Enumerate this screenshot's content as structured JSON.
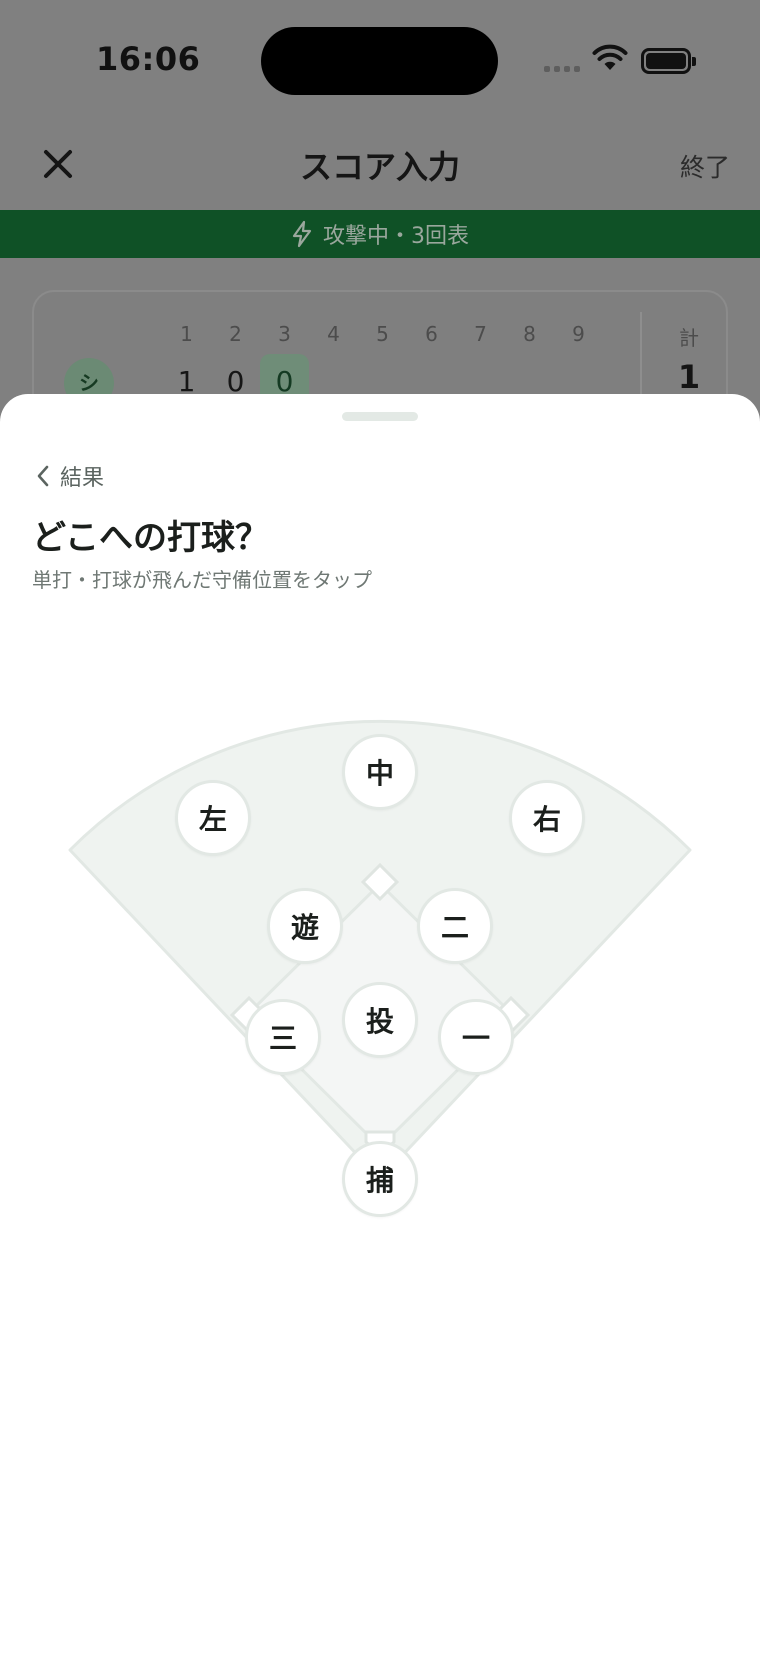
{
  "status_bar": {
    "time": "16:06"
  },
  "nav": {
    "title": "スコア入力",
    "finish_label": "終了"
  },
  "banner": {
    "text": "攻撃中・3回表"
  },
  "scoreboard": {
    "innings": [
      "1",
      "2",
      "3",
      "4",
      "5",
      "6",
      "7",
      "8",
      "9"
    ],
    "team_badge": "シ",
    "runs": [
      "1",
      "0",
      "0"
    ],
    "current_inning_index": 2,
    "total_label": "計",
    "total_value": "1"
  },
  "sheet": {
    "back_label": "結果",
    "title": "どこへの打球？",
    "subtitle": "単打・打球が飛んだ守備位置をタップ"
  },
  "positions": {
    "center": "中",
    "left": "左",
    "right": "右",
    "shortstop": "遊",
    "second": "二",
    "third": "三",
    "pitcher": "投",
    "first": "一",
    "catcher": "捕"
  },
  "colors": {
    "banner": "#0f5126",
    "field_fill": "#eff3f0",
    "field_stroke": "#e2e8e4",
    "accent": "#1a7a3a"
  }
}
